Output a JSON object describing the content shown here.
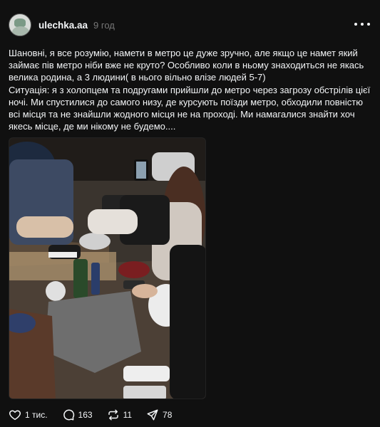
{
  "post": {
    "username": "ulechka.aa",
    "time": "9 год",
    "text": {
      "line1": "Шановні, я все розумію, намети в метро це дуже зручно, але якщо це намет який",
      "line2": "займає пів метро ніби вже не круто? Особливо коли в ньому знаходиться не якась",
      "line3": "велика родина, а 3 людини( в нього вільно влізе людей 5-7)",
      "line4": "Ситуація: я з холопцем та подругами прийшли до метро через загрозу обстрілів цієї",
      "line5": "ночі. Ми спустилися до самого низу, де курсують поїзди метро, обходили повністю",
      "line6": "всі місця та не знайшли жодного місця не на проході. Ми намагалися знайти хоч",
      "line7": "якесь місце, де ми нікому не будемо...."
    },
    "actions": {
      "likes": "1 тис.",
      "comments": "163",
      "reposts": "11",
      "shares": "78"
    },
    "icons": {
      "like": "heart-icon",
      "comment": "comment-icon",
      "repost": "repost-icon",
      "share": "send-icon",
      "more": "more-icon"
    }
  },
  "colors": {
    "background": "#101010",
    "text": "#f3f5f7",
    "muted": "#777777"
  }
}
